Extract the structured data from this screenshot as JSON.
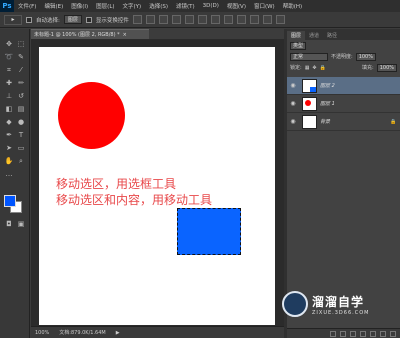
{
  "app": {
    "logo": "Ps"
  },
  "menu": [
    "文件(F)",
    "编辑(E)",
    "图像(I)",
    "图层(L)",
    "文字(Y)",
    "选择(S)",
    "滤镜(T)",
    "3D(D)",
    "视图(V)",
    "窗口(W)",
    "帮助(H)"
  ],
  "options": {
    "tool_glyph": "▸",
    "auto_select_label": "自动选择:",
    "auto_select_value": "图层",
    "show_transform_label": "显示变换控件"
  },
  "document": {
    "tab_title": "未标题-1 @ 100% (图层 2, RGB/8) *",
    "close_glyph": "×",
    "annotation_line1": "移动选区，用选框工具",
    "annotation_line2": "移动选区和内容，用移动工具",
    "zoom": "100%",
    "doc_size": "文档:879.0K/1.64M"
  },
  "colors": {
    "foreground": "#0055ff",
    "background": "#ffffff",
    "red_shape": "#ff0000",
    "blue_shape": "#0a64ff",
    "annotation": "#e8484a"
  },
  "layers_panel": {
    "tabs": [
      "图层",
      "通道",
      "路径"
    ],
    "kind_label": "类型",
    "blend_mode": "正常",
    "opacity_label": "不透明度:",
    "opacity_value": "100%",
    "lock_label": "锁定:",
    "fill_label": "填充:",
    "fill_value": "100%",
    "layers": [
      {
        "name": "图层 2",
        "selected": true
      },
      {
        "name": "图层 1",
        "selected": false
      },
      {
        "name": "背景",
        "selected": false
      }
    ]
  },
  "watermark": {
    "title": "溜溜自学",
    "url": "ZIXUE.3D66.COM"
  }
}
